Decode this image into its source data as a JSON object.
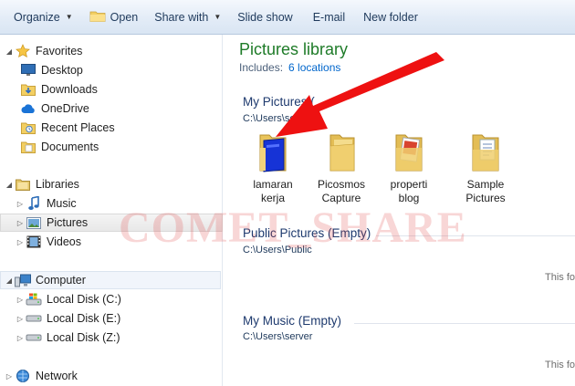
{
  "toolbar": {
    "organize": "Organize",
    "open": "Open",
    "share_with": "Share with",
    "slide_show": "Slide show",
    "email": "E-mail",
    "new_folder": "New folder"
  },
  "nav": {
    "favorites": "Favorites",
    "desktop": "Desktop",
    "downloads": "Downloads",
    "onedrive": "OneDrive",
    "recent_places": "Recent Places",
    "documents": "Documents",
    "libraries": "Libraries",
    "music": "Music",
    "pictures": "Pictures",
    "videos": "Videos",
    "computer": "Computer",
    "disk_c": "Local Disk (C:)",
    "disk_e": "Local Disk (E:)",
    "disk_z": "Local Disk (Z:)",
    "network": "Network"
  },
  "library": {
    "title": "Pictures library",
    "includes_label": "Includes:",
    "locations_link": "6 locations"
  },
  "sections": {
    "my_pictures": {
      "title": "My Pictures (",
      "path": "C:\\Users\\ser"
    },
    "public_pictures": {
      "title": "Public Pictures (Empty)",
      "path": "C:\\Users\\Public",
      "note": "This fo"
    },
    "my_music": {
      "title": "My Music (Empty)",
      "path": "C:\\Users\\server",
      "note": "This fo"
    }
  },
  "folders": [
    {
      "line1": "lamaran",
      "line2": "kerja",
      "icon": "blue-document-folder-icon"
    },
    {
      "line1": "Picosmos",
      "line2": "Capture",
      "icon": "folder-icon"
    },
    {
      "line1": "properti",
      "line2": "blog",
      "icon": "photo-folder-icon"
    },
    {
      "line1": "Sample",
      "line2": "Pictures",
      "icon": "document-folder-icon"
    }
  ],
  "watermark": "COMET_SHARE",
  "colors": {
    "library_title": "#1e7b28",
    "link": "#0066cc",
    "annotation_arrow": "#ee1111",
    "watermark": "#e14646"
  }
}
